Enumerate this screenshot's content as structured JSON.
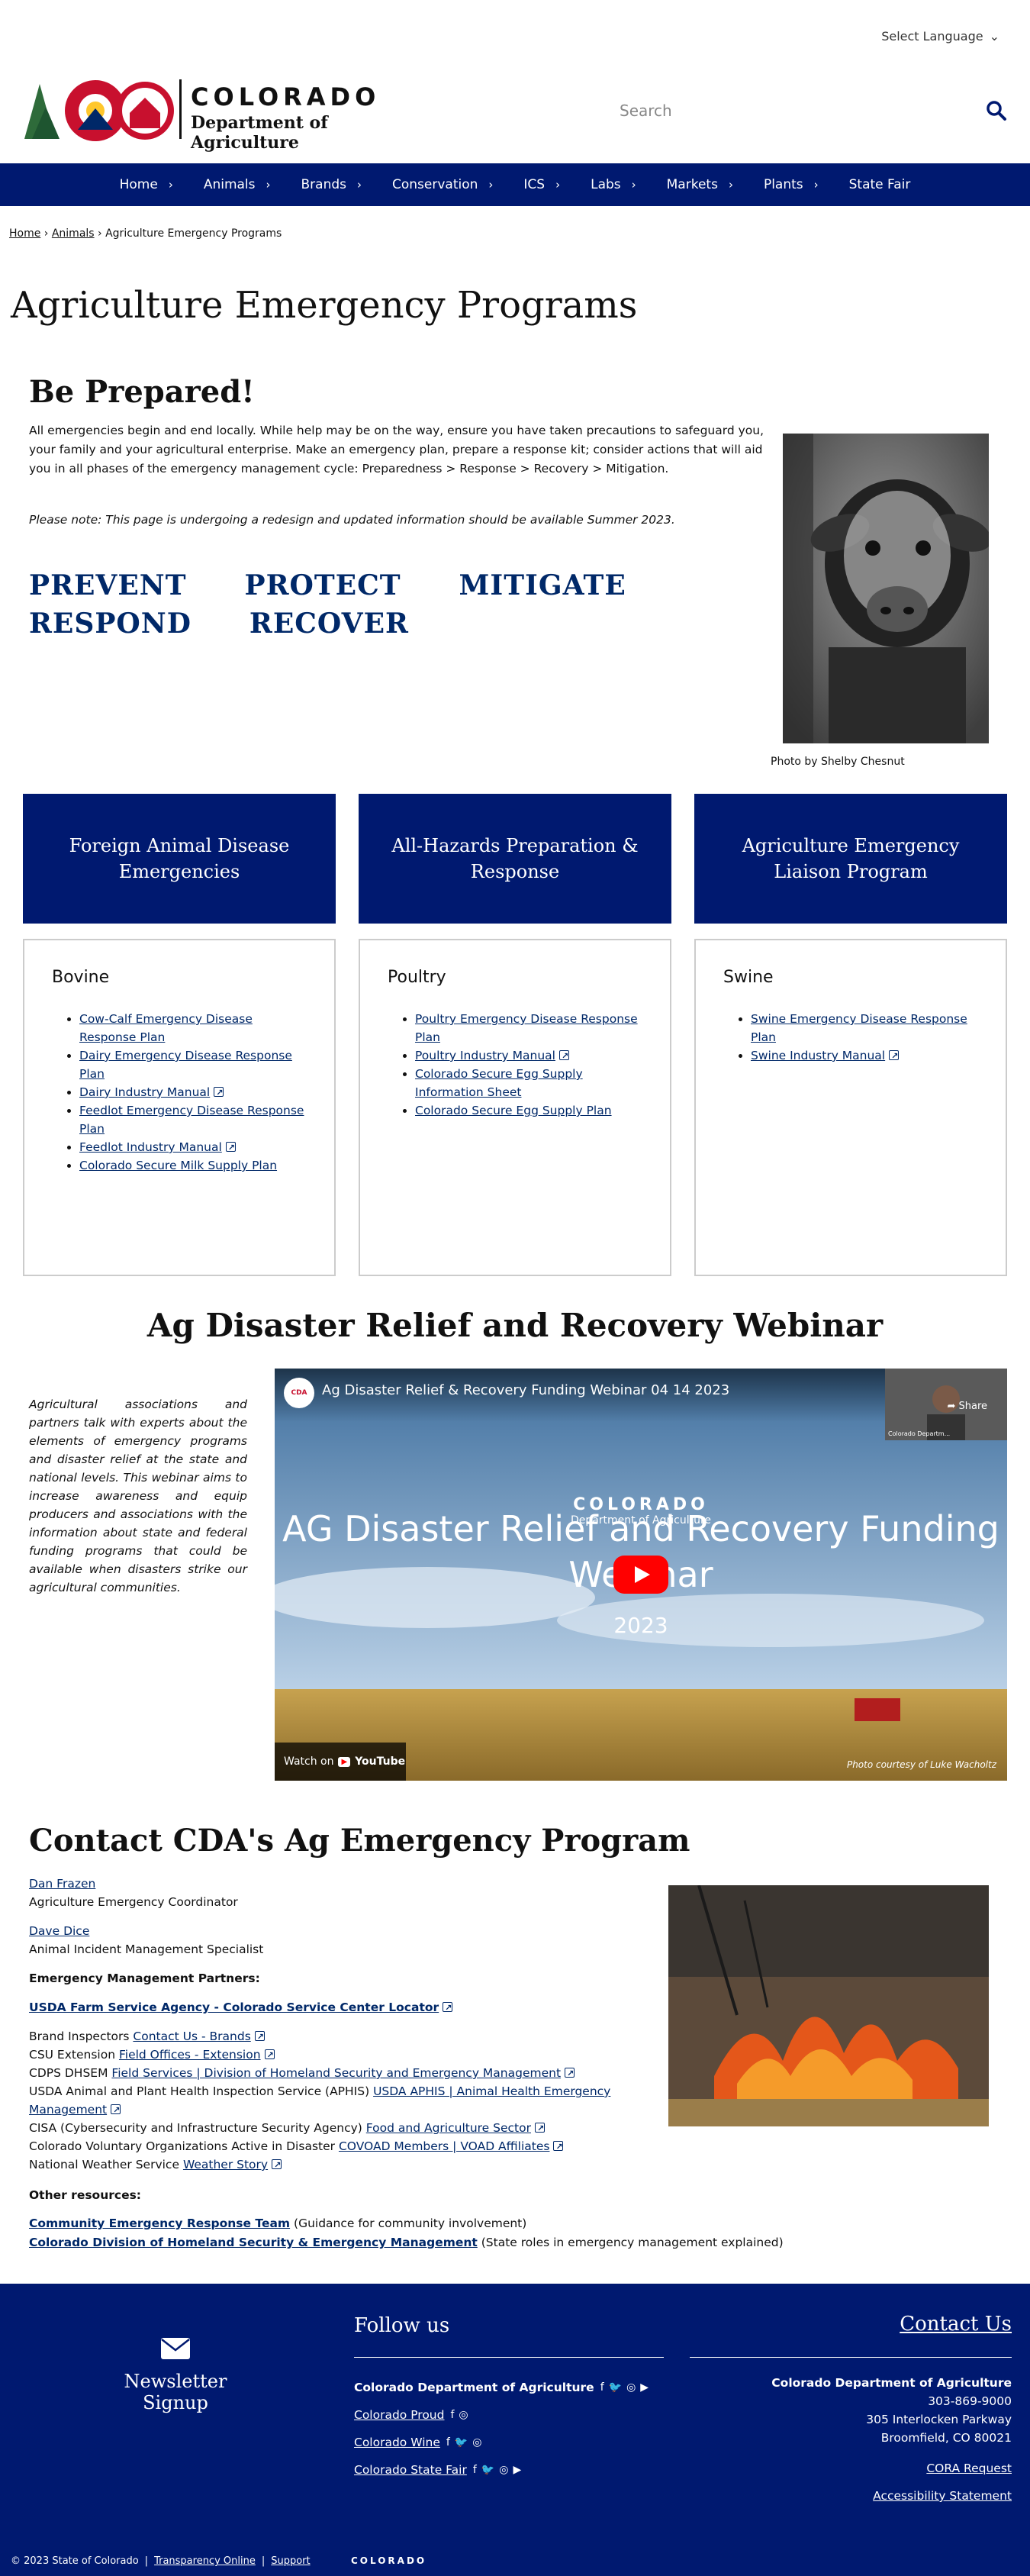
{
  "language": {
    "label": "Select Language"
  },
  "header": {
    "title": "COLORADO",
    "subtitle": "Department of Agriculture",
    "seal_text": "CDA",
    "search_placeholder": "Search"
  },
  "nav": [
    "Home",
    "Animals",
    "Brands",
    "Conservation",
    "ICS",
    "Labs",
    "Markets",
    "Plants",
    "State Fair"
  ],
  "breadcrumb": {
    "home": "Home",
    "animals": "Animals",
    "current": "Agriculture Emergency Programs"
  },
  "page_title": "Agriculture Emergency Programs",
  "prepared": {
    "title": "Be Prepared!",
    "intro": "All emergencies begin and end locally. While help may be on the way, ensure you have taken precautions to safeguard you, your family and your agricultural enterprise. Make an emergency plan, prepare a response kit; consider actions that will aid you in all phases of the emergency management cycle: Preparedness > Response > Recovery > Mitigation.",
    "note": "Please note: This page is undergoing a redesign and updated information should be available Summer 2023.",
    "phases": [
      "PREVENT",
      "PROTECT",
      "MITIGATE",
      "RESPOND",
      "RECOVER"
    ],
    "photo_credit": "Photo by Shelby Chesnut"
  },
  "programs": [
    "Foreign Animal Disease Emergencies",
    "All-Hazards Preparation & Response",
    "Agriculture Emergency Liaison Program"
  ],
  "cards": {
    "bovine": {
      "title": "Bovine",
      "links": [
        "Cow-Calf Emergency Disease Response Plan",
        "Dairy Emergency Disease Response Plan",
        "Dairy Industry Manual",
        "Feedlot Emergency Disease Response Plan",
        "Feedlot Industry Manual",
        "Colorado Secure Milk Supply Plan"
      ]
    },
    "poultry": {
      "title": "Poultry",
      "links": [
        "Poultry Emergency Disease Response Plan",
        "Poultry Industry Manual",
        "Colorado Secure Egg Supply Information Sheet",
        "Colorado Secure Egg Supply Plan"
      ]
    },
    "swine": {
      "title": "Swine",
      "links": [
        "Swine Emergency Disease Response Plan",
        "Swine Industry Manual"
      ]
    }
  },
  "webinar": {
    "title": "Ag Disaster Relief and Recovery Webinar",
    "text": "Agricultural associations and partners talk with experts about the elements of emergency programs and disaster relief at the state and national levels. This webinar aims to increase awareness and equip producers and associations with the information about state and federal funding programs that could be available when disasters strike our agricultural communities.",
    "video_title": "Ag Disaster Relief & Recovery Funding Webinar 04 14 2023",
    "video_org": "COLORADO",
    "video_dept": "Department of Agriculture",
    "video_main": "AG Disaster Relief and Recovery Funding Webinar",
    "video_year": "2023",
    "watch_on": "Watch on",
    "youtube": "YouTube",
    "share": "Share",
    "cam_label": "Colorado Departm...",
    "photo_credit": "Photo courtesy of Luke Wacholtz"
  },
  "contact": {
    "title": "Contact CDA's Ag Emergency Program",
    "p1_name": "Dan Frazen",
    "p1_role": "Agriculture Emergency Coordinator",
    "p2_name": "Dave Dice",
    "p2_role": "Animal Incident Management Specialist",
    "partners_heading": "Emergency Management Partners:",
    "fsa_link": "USDA Farm Service Agency - Colorado Service Center Locator",
    "rows": [
      {
        "prefix": "Brand Inspectors",
        "link": "Contact Us - Brands"
      },
      {
        "prefix": "CSU Extension",
        "link": "Field Offices - Extension"
      },
      {
        "prefix": "CDPS DHSEM",
        "link": "Field Services | Division of Homeland Security and Emergency Management"
      },
      {
        "prefix": "USDA Animal and Plant Health Inspection Service (APHIS)",
        "link": "USDA APHIS | Animal Health Emergency Management"
      },
      {
        "prefix": "CISA (Cybersecurity and Infrastructure Security Agency)",
        "link": "Food and Agriculture Sector"
      },
      {
        "prefix": "Colorado Voluntary Organizations Active in Disaster",
        "link": "COVOAD Members | VOAD Affiliates"
      },
      {
        "prefix": "National Weather Service",
        "link": "Weather Story"
      }
    ]
  },
  "other": {
    "heading": "Other resources:",
    "r1_link": "Community Emergency Response Team",
    "r1_text": "(Guidance for community involvement)",
    "r2_link": "Colorado Division of Homeland Security & Emergency Management",
    "r2_text": "(State roles in emergency management explained)"
  },
  "footer": {
    "newsletter": "Newsletter Signup",
    "follow": "Follow us",
    "social": [
      "Colorado Department of Agriculture",
      "Colorado Proud",
      "Colorado Wine",
      "Colorado State Fair"
    ],
    "contact_us": "Contact Us",
    "org": "Colorado Department of Agriculture",
    "phone": "303-869-9000",
    "street": "305 Interlocken Parkway",
    "city": "Broomfield, CO 80021",
    "cora": "CORA Request",
    "access": "Accessibility Statement",
    "copyright": "© 2023 State of Colorado",
    "transparency": "Transparency Online",
    "support": "Support",
    "bottom_logo": "COLORADO"
  }
}
